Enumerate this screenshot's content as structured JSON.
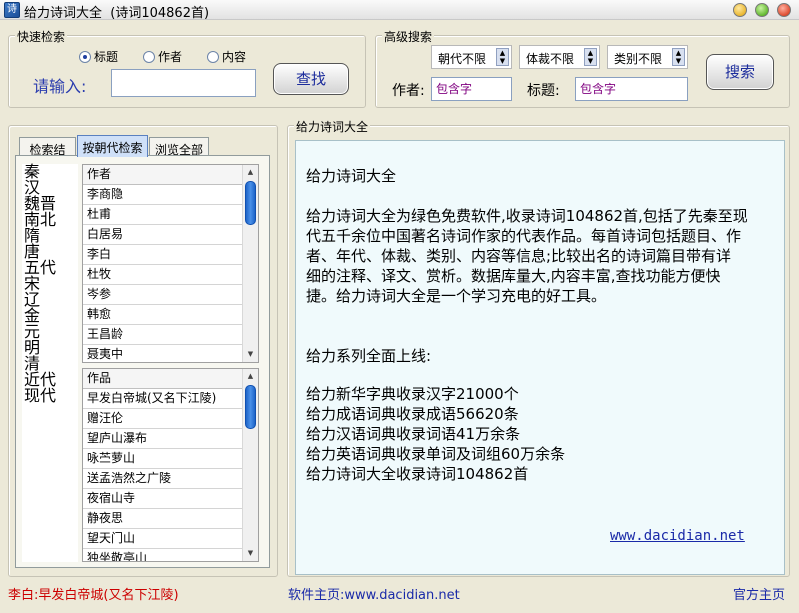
{
  "window": {
    "title": "给力诗词大全",
    "subtitle": "(诗词104862首)"
  },
  "quick_search": {
    "group_title": "快速检索",
    "options": [
      "标题",
      "作者",
      "内容"
    ],
    "selected": "标题",
    "prompt": "请输入:",
    "input_value": "",
    "button": "查找"
  },
  "advanced_search": {
    "group_title": "高级搜索",
    "dynasty_select": "朝代不限",
    "genre_select": "体裁不限",
    "category_select": "类别不限",
    "author_label": "作者:",
    "author_placeholder": "包含字",
    "title_label": "标题:",
    "title_placeholder": "包含字",
    "button": "搜索"
  },
  "tabs": [
    "检索结果",
    "按朝代检索",
    "浏览全部"
  ],
  "active_tab": "按朝代检索",
  "dynasties": [
    "秦",
    "汉",
    "魏晋",
    "南北",
    "隋",
    "唐",
    "五代",
    "宋",
    "辽",
    "金",
    "元",
    "明",
    "清",
    "近代",
    "现代"
  ],
  "authors": {
    "header": "作者",
    "items": [
      "李商隐",
      "杜甫",
      "白居易",
      "李白",
      "杜牧",
      "岑参",
      "韩愈",
      "王昌龄",
      "聂夷中"
    ]
  },
  "works": {
    "header": "作品",
    "items": [
      "早发白帝城(又名下江陵)",
      "赠汪伦",
      "望庐山瀑布",
      "咏苎萝山",
      "送孟浩然之广陵",
      "夜宿山寺",
      "静夜思",
      "望天门山",
      "独坐敬亭山"
    ]
  },
  "content": {
    "group_title": "给力诗词大全",
    "heading": "给力诗词大全",
    "paragraph_lines": [
      "给力诗词大全为绿色免费软件,收录诗词104862首,包括了先秦至现",
      "代五千余位中国著名诗词作家的代表作品。每首诗词包括题目、作",
      "者、年代、体裁、类别、内容等信息;比较出名的诗词篇目带有详",
      "细的注释、译文、赏析。数据库量大,内容丰富,查找功能方便快",
      "捷。给力诗词大全是一个学习充电的好工具。"
    ],
    "series_title": "给力系列全面上线:",
    "series_lines": [
      "给力新华字典收录汉字21000个",
      "给力成语词典收录成语56620条",
      "给力汉语词典收录词语41万余条",
      "给力英语词典收录单词及词组60万余条",
      "给力诗词大全收录诗词104862首"
    ],
    "website_link": "www.dacidian.net"
  },
  "status_bar": {
    "current_poem": "李白:早发白帝城(又名下江陵)",
    "homepage_text": "软件主页:www.dacidian.net",
    "official_link": "官方主页"
  },
  "colors": {
    "window_bg": "#ece9d8",
    "content_bg": "#f0fafc",
    "accent_blue": "#1a2aa8",
    "status_red": "#cc0000"
  }
}
